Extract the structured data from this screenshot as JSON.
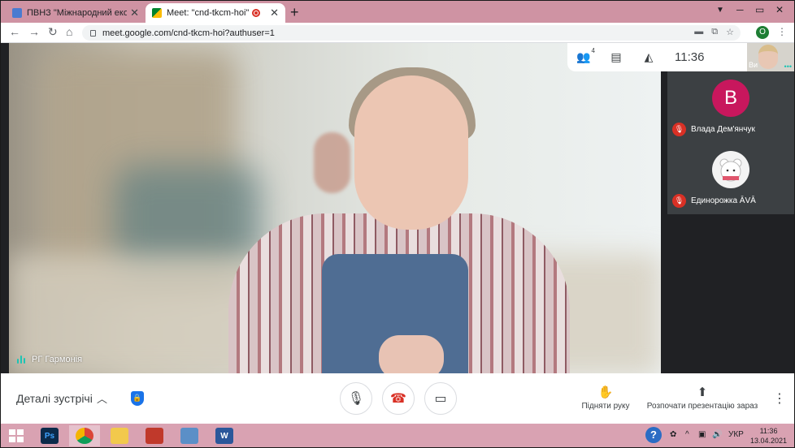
{
  "browser": {
    "tabs": [
      {
        "title": "ПВНЗ \"Міжнародний економік",
        "favicon_color": "#4a7bd0"
      },
      {
        "title": "Meet: \"cnd-tkcm-hoi\"",
        "favicon_color": "#00832d"
      }
    ],
    "url": "meet.google.com/cnd-tkcm-hoi?authuser=1",
    "profile_initial": "O"
  },
  "meet": {
    "participant_count": "4",
    "time": "11:36",
    "self_label": "Ви",
    "speaker_name": "РГ Гармонія",
    "participants": [
      {
        "initial": "B",
        "name": "Влада Дем'янчук",
        "avatar_color": "#c8175d"
      },
      {
        "initial": "",
        "name": "Единорожка ĀVĀ",
        "avatar_color": "#f3f3f3"
      }
    ]
  },
  "bottom": {
    "details_label": "Деталі зустрічі",
    "raise_hand_label": "Підняти руку",
    "present_label": "Розпочати презентацію зараз"
  },
  "taskbar": {
    "lang": "УКР",
    "time": "11:36",
    "date": "13.04.2021"
  }
}
